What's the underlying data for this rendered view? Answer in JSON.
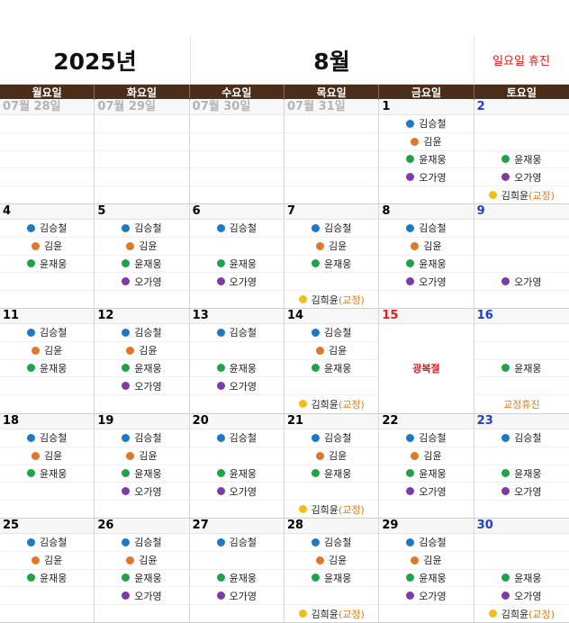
{
  "header": {
    "year": "2025년",
    "month": "8월",
    "note": "일요일 휴진"
  },
  "weekdays": [
    "월요일",
    "화요일",
    "수요일",
    "목요일",
    "금요일",
    "토요일"
  ],
  "colors": {
    "김승철": "#1f78c4",
    "김윤": "#e0782a",
    "윤재웅": "#1ea34a",
    "오가영": "#7d3aa8",
    "김희윤": "#f2bd16"
  },
  "weeks": [
    {
      "days": [
        {
          "num": "07월 28일",
          "style": "gray",
          "slots": []
        },
        {
          "num": "07월 29일",
          "style": "gray",
          "slots": []
        },
        {
          "num": "07월 30일",
          "style": "gray",
          "slots": []
        },
        {
          "num": "07월 31일",
          "style": "gray",
          "slots": []
        },
        {
          "num": "1",
          "style": "",
          "slots": [
            {
              "name": "김승철"
            },
            {
              "name": "김윤"
            },
            {
              "name": "윤재웅"
            },
            {
              "name": "오가영"
            },
            null
          ]
        },
        {
          "num": "2",
          "style": "blue",
          "slots": [
            null,
            null,
            {
              "name": "윤재웅"
            },
            {
              "name": "오가영"
            },
            {
              "name": "김희윤",
              "suffix": "(교정)"
            }
          ]
        }
      ]
    },
    {
      "days": [
        {
          "num": "4",
          "style": "",
          "slots": [
            {
              "name": "김승철"
            },
            {
              "name": "김윤"
            },
            {
              "name": "윤재웅"
            },
            null,
            null
          ]
        },
        {
          "num": "5",
          "style": "",
          "slots": [
            {
              "name": "김승철"
            },
            {
              "name": "김윤"
            },
            {
              "name": "윤재웅"
            },
            {
              "name": "오가영"
            },
            null
          ]
        },
        {
          "num": "6",
          "style": "",
          "slots": [
            {
              "name": "김승철"
            },
            null,
            {
              "name": "윤재웅"
            },
            {
              "name": "오가영"
            },
            null
          ]
        },
        {
          "num": "7",
          "style": "",
          "slots": [
            {
              "name": "김승철"
            },
            {
              "name": "김윤"
            },
            {
              "name": "윤재웅"
            },
            null,
            {
              "name": "김희윤",
              "suffix": "(교정)"
            }
          ]
        },
        {
          "num": "8",
          "style": "",
          "slots": [
            {
              "name": "김승철"
            },
            {
              "name": "김윤"
            },
            {
              "name": "윤재웅"
            },
            {
              "name": "오가영"
            },
            null
          ]
        },
        {
          "num": "9",
          "style": "blue",
          "slots": [
            null,
            null,
            null,
            {
              "name": "오가영"
            },
            null
          ]
        }
      ]
    },
    {
      "days": [
        {
          "num": "11",
          "style": "",
          "slots": [
            {
              "name": "김승철"
            },
            {
              "name": "김윤"
            },
            {
              "name": "윤재웅"
            },
            null,
            null
          ]
        },
        {
          "num": "12",
          "style": "",
          "slots": [
            {
              "name": "김승철"
            },
            {
              "name": "김윤"
            },
            {
              "name": "윤재웅"
            },
            {
              "name": "오가영"
            },
            null
          ]
        },
        {
          "num": "13",
          "style": "",
          "slots": [
            {
              "name": "김승철"
            },
            null,
            {
              "name": "윤재웅"
            },
            {
              "name": "오가영"
            },
            null
          ]
        },
        {
          "num": "14",
          "style": "",
          "slots": [
            {
              "name": "김승철"
            },
            {
              "name": "김윤"
            },
            {
              "name": "윤재웅"
            },
            null,
            {
              "name": "김희윤",
              "suffix": "(교정)"
            }
          ]
        },
        {
          "num": "15",
          "style": "red",
          "holiday": "광복절",
          "slots": []
        },
        {
          "num": "16",
          "style": "blue",
          "slots": [
            null,
            null,
            {
              "name": "윤재웅"
            },
            null,
            {
              "text": "교정휴진"
            }
          ]
        }
      ]
    },
    {
      "days": [
        {
          "num": "18",
          "style": "",
          "slots": [
            {
              "name": "김승철"
            },
            {
              "name": "김윤"
            },
            {
              "name": "윤재웅"
            },
            null,
            null
          ]
        },
        {
          "num": "19",
          "style": "",
          "slots": [
            {
              "name": "김승철"
            },
            {
              "name": "김윤"
            },
            {
              "name": "윤재웅"
            },
            {
              "name": "오가영"
            },
            null
          ]
        },
        {
          "num": "20",
          "style": "",
          "slots": [
            {
              "name": "김승철"
            },
            null,
            {
              "name": "윤재웅"
            },
            {
              "name": "오가영"
            },
            null
          ]
        },
        {
          "num": "21",
          "style": "",
          "slots": [
            {
              "name": "김승철"
            },
            {
              "name": "김윤"
            },
            {
              "name": "윤재웅"
            },
            null,
            {
              "name": "김희윤",
              "suffix": "(교정)"
            }
          ]
        },
        {
          "num": "22",
          "style": "",
          "slots": [
            {
              "name": "김승철"
            },
            {
              "name": "김윤"
            },
            {
              "name": "윤재웅"
            },
            {
              "name": "오가영"
            },
            null
          ]
        },
        {
          "num": "23",
          "style": "blue",
          "slots": [
            {
              "name": "김승철"
            },
            null,
            {
              "name": "윤재웅"
            },
            {
              "name": "오가영"
            },
            null
          ]
        }
      ]
    },
    {
      "days": [
        {
          "num": "25",
          "style": "",
          "slots": [
            {
              "name": "김승철"
            },
            {
              "name": "김윤"
            },
            {
              "name": "윤재웅"
            },
            null,
            null
          ]
        },
        {
          "num": "26",
          "style": "",
          "slots": [
            {
              "name": "김승철"
            },
            {
              "name": "김윤"
            },
            {
              "name": "윤재웅"
            },
            {
              "name": "오가영"
            },
            null
          ]
        },
        {
          "num": "27",
          "style": "",
          "slots": [
            {
              "name": "김승철"
            },
            null,
            {
              "name": "윤재웅"
            },
            {
              "name": "오가영"
            },
            null
          ]
        },
        {
          "num": "28",
          "style": "",
          "slots": [
            {
              "name": "김승철"
            },
            {
              "name": "김윤"
            },
            {
              "name": "윤재웅"
            },
            null,
            {
              "name": "김희윤",
              "suffix": "(교정)"
            }
          ]
        },
        {
          "num": "29",
          "style": "",
          "slots": [
            {
              "name": "김승철"
            },
            {
              "name": "김윤"
            },
            {
              "name": "윤재웅"
            },
            {
              "name": "오가영"
            },
            null
          ]
        },
        {
          "num": "30",
          "style": "blue",
          "slots": [
            null,
            null,
            {
              "name": "윤재웅"
            },
            {
              "name": "오가영"
            },
            {
              "name": "김희윤",
              "suffix": "(교정)"
            }
          ]
        }
      ]
    }
  ]
}
